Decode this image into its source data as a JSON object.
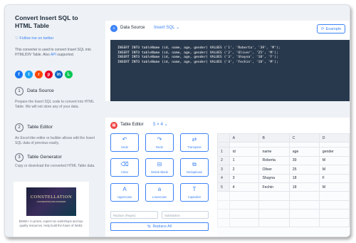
{
  "sidebar": {
    "title": "Convert Insert SQL to HTML Table",
    "twitter": "Follow me on twitter",
    "desc_main": "This converter is used to convert Insert SQL into HTML/DIV Table. Also",
    "desc_api": "API",
    "desc_end": "supported.",
    "socials": [
      {
        "icon": "facebook-icon",
        "glyph": "f",
        "color": "#1877f2"
      },
      {
        "icon": "twitter-icon",
        "glyph": "t",
        "color": "#1da1f2"
      },
      {
        "icon": "reddit-icon",
        "glyph": "r",
        "color": "#ff4500"
      },
      {
        "icon": "pinterest-icon",
        "glyph": "p",
        "color": "#e60023"
      },
      {
        "icon": "linkedin-icon",
        "glyph": "in",
        "color": "#0a66c2"
      },
      {
        "icon": "line-icon",
        "glyph": "L",
        "color": "#06c755"
      }
    ],
    "steps": [
      {
        "num": "1",
        "title": "Data Source",
        "desc": "Prepare the Insert SQL code to convert into HTML Table. We will not store any of your data."
      },
      {
        "num": "2",
        "title": "Table Editor",
        "desc": "An Excel-like editor or builder allows edit the Insert SQL data of previous easily."
      },
      {
        "num": "3",
        "title": "Table Generator",
        "desc": "Copy or download the converted HTML Table data."
      }
    ],
    "ad": {
      "image_title": "CONSTELLATION",
      "image_subtitle": "A FOUNDATION FOR FOUNDERS",
      "text": "$350K+ in prizes, expert-run workshops and top-quality resources. Help build the future of Web3."
    }
  },
  "data_source": {
    "title": "Data Source",
    "format": "Insert SQL",
    "example_label": "Example",
    "code": [
      "INSERT INTO tableName (id, name, age, gender) VALUES ('1', 'Roberta', '39', 'M');",
      "INSERT INTO tableName (id, name, age, gender) VALUES ('2', 'Oliver', '25', 'M');",
      "INSERT INTO tableName (id, name, age, gender) VALUES ('3', 'Shayna', '18', 'F');",
      "INSERT INTO tableName (id, name, age, gender) VALUES ('4', 'Fechin', '18', 'M');"
    ]
  },
  "table_editor": {
    "title": "Table Editor",
    "size": "5 × 4",
    "tools": [
      {
        "label": "Undo",
        "icon": "undo-icon",
        "glyph": "↶"
      },
      {
        "label": "Redo",
        "icon": "redo-icon",
        "glyph": "↷"
      },
      {
        "label": "Transpose",
        "icon": "transpose-icon",
        "glyph": "⇄"
      },
      {
        "label": "Clear",
        "icon": "clear-icon",
        "glyph": "⌫"
      },
      {
        "label": "Delete Blank",
        "icon": "delete-blank-icon",
        "glyph": "⊟"
      },
      {
        "label": "Deduplicate",
        "icon": "deduplicate-icon",
        "glyph": "⧉"
      },
      {
        "label": "Uppercase",
        "icon": "uppercase-icon",
        "glyph": "A"
      },
      {
        "label": "Lowercase",
        "icon": "lowercase-icon",
        "glyph": "a"
      },
      {
        "label": "Capitalize",
        "icon": "capitalize-icon",
        "glyph": "T"
      }
    ],
    "replace_placeholder": "Replace (Regex)",
    "substitution_placeholder": "Substitution",
    "replace_all_label": "Replace All",
    "grid": {
      "col_headers": [
        "A",
        "B",
        "C",
        "D"
      ],
      "rows": [
        {
          "num": "1",
          "cells": [
            "id",
            "name",
            "age",
            "gender"
          ]
        },
        {
          "num": "2",
          "cells": [
            "1",
            "Roberta",
            "39",
            "M"
          ]
        },
        {
          "num": "3",
          "cells": [
            "2",
            "Oliver",
            "25",
            "M"
          ]
        },
        {
          "num": "4",
          "cells": [
            "3",
            "Shayna",
            "18",
            "F"
          ]
        },
        {
          "num": "5",
          "cells": [
            "4",
            "Fechin",
            "18",
            "M"
          ]
        }
      ]
    }
  }
}
